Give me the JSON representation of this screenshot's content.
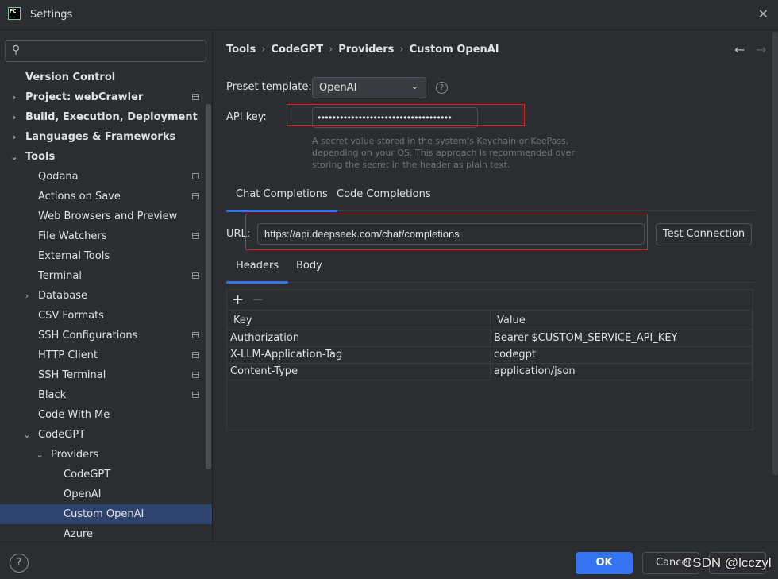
{
  "window": {
    "title": "Settings",
    "logo_text": "PC"
  },
  "search": {
    "placeholder": ""
  },
  "tree": [
    {
      "label": "Version Control"
    },
    {
      "label": "Project: webCrawler"
    },
    {
      "label": "Build, Execution, Deployment"
    },
    {
      "label": "Languages & Frameworks"
    },
    {
      "label": "Tools"
    },
    {
      "label": "Qodana"
    },
    {
      "label": "Actions on Save"
    },
    {
      "label": "Web Browsers and Preview"
    },
    {
      "label": "File Watchers"
    },
    {
      "label": "External Tools"
    },
    {
      "label": "Terminal"
    },
    {
      "label": "Database"
    },
    {
      "label": "CSV Formats"
    },
    {
      "label": "SSH Configurations"
    },
    {
      "label": "HTTP Client"
    },
    {
      "label": "SSH Terminal"
    },
    {
      "label": "Black"
    },
    {
      "label": "Code With Me"
    },
    {
      "label": "CodeGPT"
    },
    {
      "label": "Providers"
    },
    {
      "label": "CodeGPT"
    },
    {
      "label": "OpenAI"
    },
    {
      "label": "Custom OpenAI"
    },
    {
      "label": "Azure"
    }
  ],
  "breadcrumb": {
    "items": [
      "Tools",
      "CodeGPT",
      "Providers",
      "Custom OpenAI"
    ],
    "separator": "›"
  },
  "form": {
    "preset_label": "Preset template:",
    "preset_value": "OpenAI",
    "api_key_label": "API key:",
    "api_key_value": "••••••••••••••••••••••••••••••••••••",
    "hint": "A secret value stored in the system's Keychain or KeePass, depending on your OS. This approach is recommended over storing the secret in the header as plain text.",
    "url_label": "URL:",
    "url_value": "https://api.deepseek.com/chat/completions",
    "test_connection": "Test Connection"
  },
  "tabs": {
    "completion": [
      "Chat Completions",
      "Code Completions"
    ],
    "request": [
      "Headers",
      "Body"
    ]
  },
  "headers_table": {
    "columns": [
      "Key",
      "Value"
    ],
    "rows": [
      [
        "Authorization",
        "Bearer $CUSTOM_SERVICE_API_KEY"
      ],
      [
        "X-LLM-Application-Tag",
        "codegpt"
      ],
      [
        "Content-Type",
        "application/json"
      ]
    ]
  },
  "footer": {
    "help": "?",
    "ok": "OK",
    "cancel": "Cancel",
    "watermark": "CSDN @lcczyl"
  },
  "colors": {
    "accent": "#3574f0",
    "selection": "#2e436e",
    "highlight_box": "#e02020",
    "background": "#2b2d30"
  }
}
